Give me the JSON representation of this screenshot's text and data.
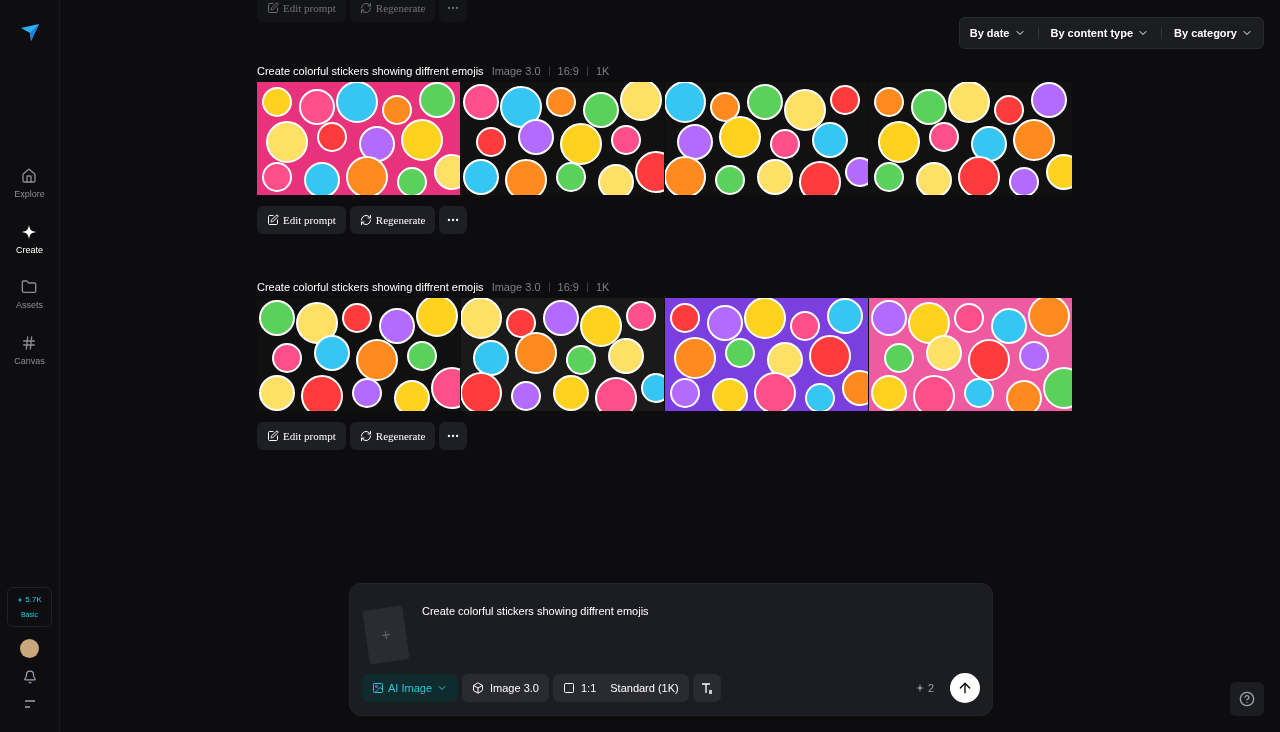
{
  "sidebar": {
    "nav": [
      {
        "label": "Explore",
        "selected": false
      },
      {
        "label": "Create",
        "selected": true
      },
      {
        "label": "Assets",
        "selected": false
      },
      {
        "label": "Canvas",
        "selected": false
      }
    ],
    "credits": {
      "amount": "5.7K",
      "plan": "Basic"
    }
  },
  "previous_actions": [
    "Edit prompt",
    "Regenerate"
  ],
  "filters": [
    "By date",
    "By content type",
    "By category"
  ],
  "generations": [
    {
      "prompt": "Create colorful stickers showing diffrent emojis",
      "model": "Image 3.0",
      "ratio": "16:9",
      "resolution": "1K",
      "images": [
        {
          "kind": "photo"
        },
        {
          "kind": "photo"
        },
        {
          "kind": "photo"
        },
        {
          "kind": "photo"
        }
      ],
      "actions": [
        "Edit prompt",
        "Regenerate"
      ]
    },
    {
      "prompt": "Create colorful stickers showing diffrent emojis",
      "model": "Image 3.0",
      "ratio": "16:9",
      "resolution": "1K",
      "images": [
        {
          "kind": "photo"
        },
        {
          "kind": "photo"
        },
        {
          "kind": "photo"
        },
        {
          "kind": "photo"
        }
      ],
      "actions": [
        "Edit prompt",
        "Regenerate"
      ]
    }
  ],
  "composer": {
    "prompt": "Create colorful stickers showing diffrent emojis",
    "mode": "AI Image",
    "model": "Image 3.0",
    "ratio": "1:1",
    "quality": "Standard (1K)",
    "cost": "2"
  }
}
